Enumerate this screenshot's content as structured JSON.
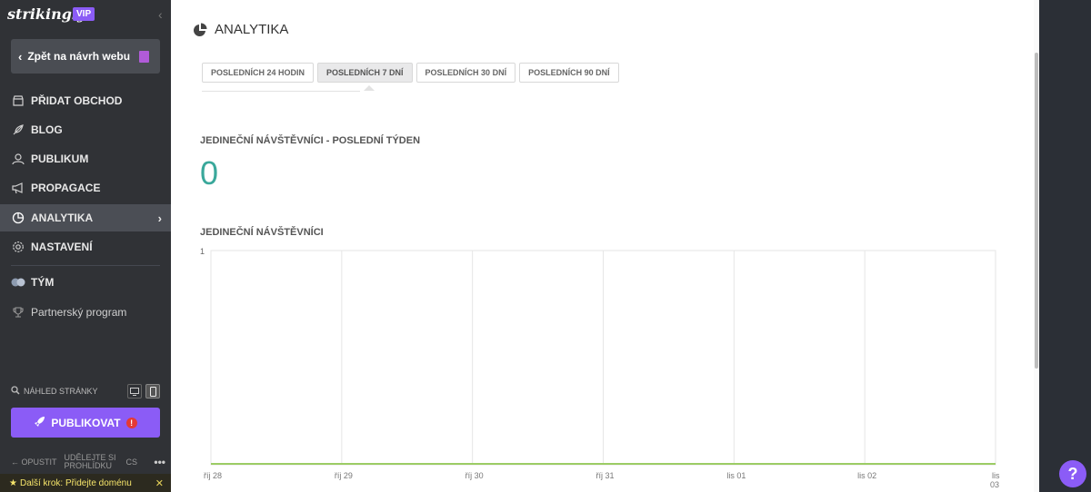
{
  "sidebar": {
    "brand": "strikingly",
    "badge": "VIP",
    "back_label": "Zpět na návrh webu",
    "items": [
      {
        "label": "PŘIDAT OBCHOD",
        "icon": "store-icon"
      },
      {
        "label": "BLOG",
        "icon": "quill-icon"
      },
      {
        "label": "PUBLIKUM",
        "icon": "people-icon"
      },
      {
        "label": "PROPAGACE",
        "icon": "megaphone-icon"
      },
      {
        "label": "ANALYTIKA",
        "icon": "pie-chart-icon",
        "active": true
      },
      {
        "label": "NASTAVENÍ",
        "icon": "gear-icon"
      }
    ],
    "team_label": "TÝM",
    "partner_label": "Partnerský program",
    "preview_label": "NÁHLED STRÁNKY",
    "publish_label": "PUBLIKOVAT",
    "publish_alert": "!",
    "exit_label": "OPUSTIT",
    "share_label": "UDĚLEJTE SI PROHLÍDKU",
    "lang": "CS",
    "more": "•••",
    "next_step": "Další krok: Přidejte doménu"
  },
  "main": {
    "title": "ANALYTIKA",
    "tabs": [
      "POSLEDNÍCH 24 HODIN",
      "POSLEDNÍCH 7 DNÍ",
      "POSLEDNÍCH 30 DNÍ",
      "POSLEDNÍCH 90 DNÍ"
    ],
    "active_tab": 1,
    "unique_week_title": "JEDINEČNÍ NÁVŠTĚVNÍCI - POSLEDNÍ TÝDEN",
    "unique_week_value": "0",
    "chart_title": "JEDINEČNÍ NÁVŠTĚVNÍCI"
  },
  "help_label": "?",
  "chart_data": {
    "type": "line",
    "title": "JEDINEČNÍ NÁVŠTĚVNÍCI",
    "categories": [
      "říj 28",
      "říj 29",
      "říj 30",
      "říj 31",
      "lis 01",
      "lis 02",
      "lis 03"
    ],
    "series": [
      {
        "values": [
          0,
          0,
          0,
          0,
          0,
          0,
          0
        ]
      }
    ],
    "ylim": [
      0,
      1
    ],
    "yticks": [
      "1"
    ],
    "grid": true,
    "colors": {
      "line": "#9ccc65",
      "grid": "#e6e6e6"
    }
  }
}
